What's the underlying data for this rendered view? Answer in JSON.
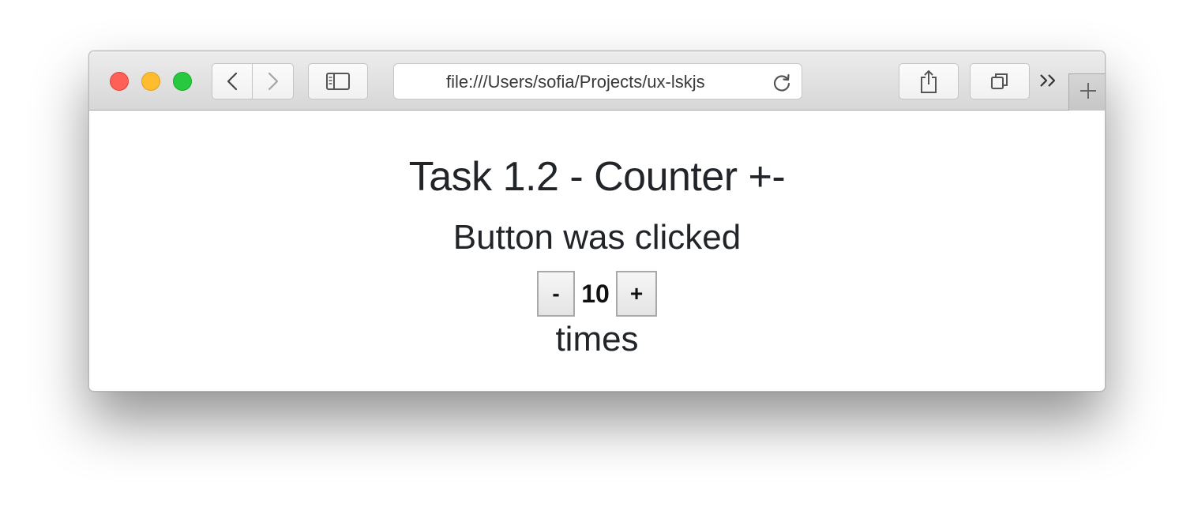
{
  "browser": {
    "address_url": "file:///Users/sofia/Projects/ux-lskjs",
    "traffic_lights": [
      "close",
      "minimize",
      "zoom"
    ],
    "icons": {
      "back": "chevron-left-icon",
      "forward": "chevron-right-icon",
      "sidebar": "sidebar-icon",
      "reload": "reload-icon",
      "share": "share-icon",
      "tabs": "tabs-overview-icon",
      "overflow": "double-chevron-icon",
      "new_tab": "plus-icon"
    }
  },
  "page": {
    "heading": "Task 1.2 - Counter +-",
    "subtitle": "Button was clicked",
    "counter": {
      "decrement_label": "-",
      "value": "10",
      "increment_label": "+"
    },
    "suffix": "times"
  },
  "colors": {
    "close": "#fe5f57",
    "minimize": "#febc2e",
    "zoom": "#28c840",
    "text": "#212529"
  }
}
